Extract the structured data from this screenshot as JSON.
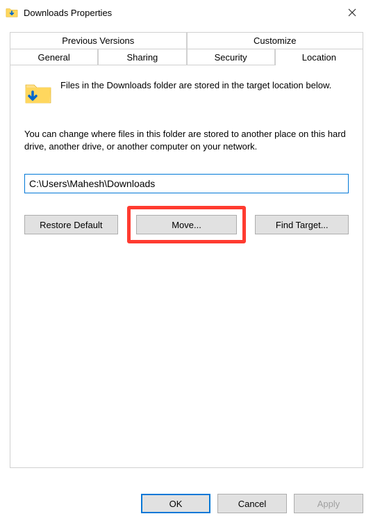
{
  "titlebar": {
    "title": "Downloads Properties"
  },
  "tabs": {
    "row1": [
      "Previous Versions",
      "Customize"
    ],
    "row2": [
      "General",
      "Sharing",
      "Security",
      "Location"
    ],
    "active": "Location"
  },
  "panel": {
    "desc1": "Files in the Downloads folder are stored in the target location below.",
    "desc2": "You can change where files in this folder are stored to another place on this hard drive, another drive, or another computer on your network.",
    "path_value": "C:\\Users\\Mahesh\\Downloads",
    "buttons": {
      "restore": "Restore Default",
      "move": "Move...",
      "find": "Find Target..."
    }
  },
  "bottom": {
    "ok": "OK",
    "cancel": "Cancel",
    "apply": "Apply"
  }
}
